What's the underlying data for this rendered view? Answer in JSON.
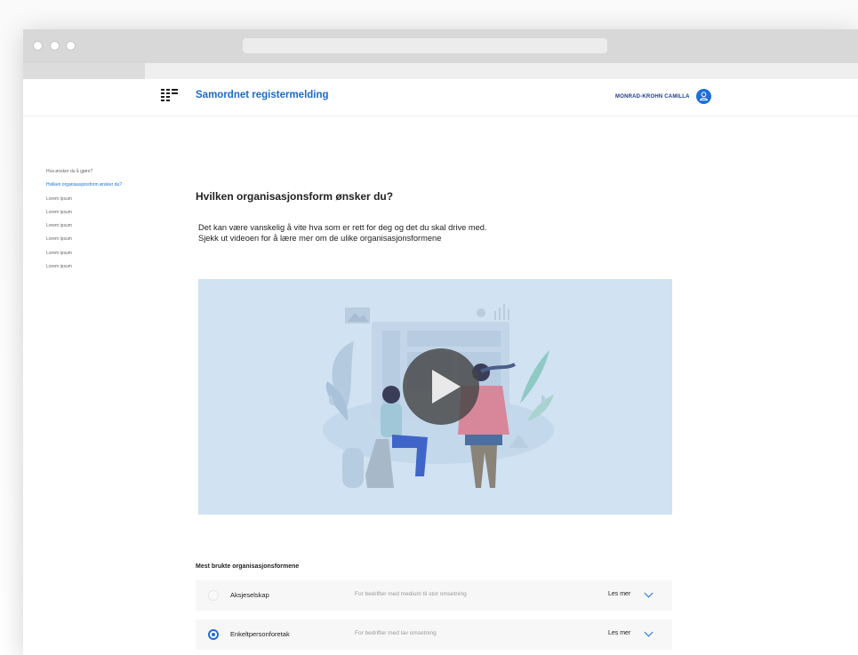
{
  "app": {
    "title": "Samordnet registermelding",
    "user_name": "MONRAD-KROHN CAMILLA"
  },
  "sidebar": {
    "items": [
      {
        "label": "Hva ønsker du å gjøre?",
        "active": false
      },
      {
        "label": "Hvilken organisasjonsform ønsker du?",
        "active": true
      },
      {
        "label": "Lorem ipsum",
        "active": false
      },
      {
        "label": "Lorem ipsum",
        "active": false
      },
      {
        "label": "Lorem ipsum",
        "active": false
      },
      {
        "label": "Lorem ipsum",
        "active": false
      },
      {
        "label": "Lorem ipsum",
        "active": false
      },
      {
        "label": "Lorem ipsum",
        "active": false
      }
    ]
  },
  "main": {
    "heading": "Hvilken organisasjonsform ønsker du?",
    "intro_line1": "Det kan være vanskelig å vite hva som er rett for deg og det du skal drive med.",
    "intro_line2": "Sjekk ut videoen for å lære mer om de ulike organisasjonsformene",
    "section_title": "Mest brukte organisasjonsformene",
    "options": [
      {
        "name": "Aksjeselskap",
        "description": "For bedrifter med medium til stor omsetning",
        "more": "Les mer",
        "selected": false
      },
      {
        "name": "Enkeltpersonforetak",
        "description": "For bedrifter med lav omsetning",
        "more": "Les mer",
        "selected": true
      }
    ]
  },
  "colors": {
    "accent": "#1e6fd6",
    "title_blue": "#1c6bc6",
    "video_bg": "#d1e2f2"
  },
  "icons": {
    "logo": "brreg-logo-icon",
    "user": "user-icon",
    "play": "play-icon",
    "expand": "chevron-down-icon"
  }
}
